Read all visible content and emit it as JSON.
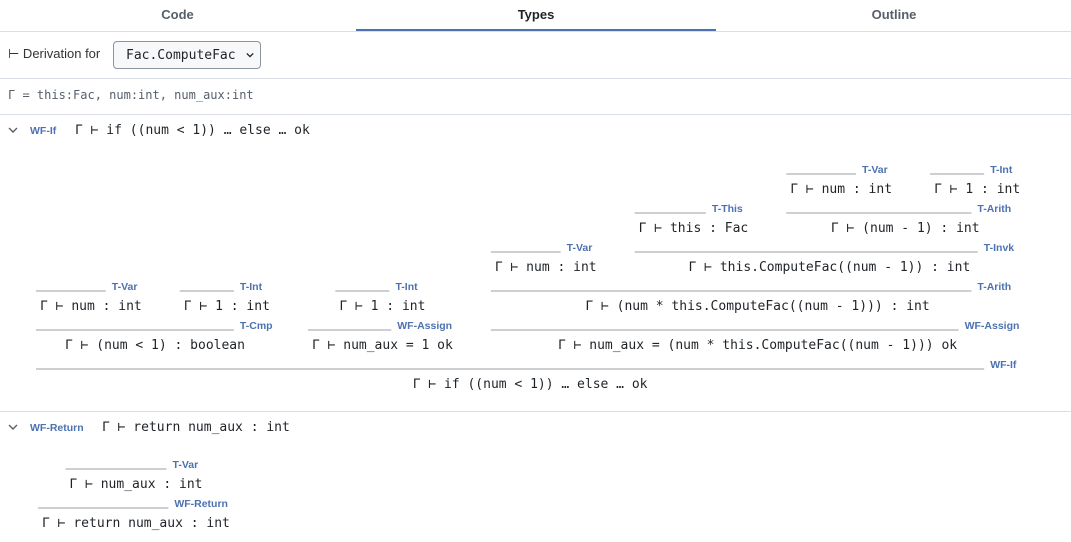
{
  "tabs": [
    {
      "label": "Code",
      "active": false
    },
    {
      "label": "Types",
      "active": true
    },
    {
      "label": "Outline",
      "active": false
    }
  ],
  "derivation": {
    "label": "⊢ Derivation for",
    "selected": "Fac.ComputeFac"
  },
  "context": "Γ = this:Fac, num:int, num_aux:int",
  "sections": [
    {
      "rule": "WF-If",
      "judgment": "Γ ⊢ if ((num < 1)) … else … ok",
      "tree": {
        "rule": "WF-If",
        "judgment": "Γ ⊢ if ((num < 1)) … else … ok",
        "premises": [
          {
            "rule": "T-Cmp",
            "judgment": "Γ ⊢ (num < 1) : boolean",
            "premises": [
              {
                "rule": "T-Var",
                "judgment": "Γ ⊢ num : int"
              },
              {
                "rule": "T-Int",
                "judgment": "Γ ⊢ 1 : int"
              }
            ]
          },
          {
            "rule": "WF-Assign",
            "judgment": "Γ ⊢ num_aux = 1 ok",
            "premises": [
              {
                "rule": "T-Int",
                "judgment": "Γ ⊢ 1 : int"
              }
            ]
          },
          {
            "rule": "WF-Assign",
            "judgment": "Γ ⊢ num_aux = (num * this.ComputeFac((num - 1))) ok",
            "premises": [
              {
                "rule": "T-Arith",
                "judgment": "Γ ⊢ (num * this.ComputeFac((num - 1))) : int",
                "premises": [
                  {
                    "rule": "T-Var",
                    "judgment": "Γ ⊢ num : int"
                  },
                  {
                    "rule": "T-Invk",
                    "judgment": "Γ ⊢ this.ComputeFac((num - 1)) : int",
                    "premises": [
                      {
                        "rule": "T-This",
                        "judgment": "Γ ⊢ this : Fac"
                      },
                      {
                        "rule": "T-Arith",
                        "judgment": "Γ ⊢ (num - 1) : int",
                        "premises": [
                          {
                            "rule": "T-Var",
                            "judgment": "Γ ⊢ num : int"
                          },
                          {
                            "rule": "T-Int",
                            "judgment": "Γ ⊢ 1 : int"
                          }
                        ]
                      }
                    ]
                  }
                ]
              }
            ]
          }
        ]
      }
    },
    {
      "rule": "WF-Return",
      "judgment": "Γ ⊢ return num_aux : int",
      "tree": {
        "rule": "WF-Return",
        "judgment": "Γ ⊢ return num_aux : int",
        "premises": [
          {
            "rule": "T-Var",
            "judgment": "Γ ⊢ num_aux : int"
          }
        ]
      }
    }
  ]
}
